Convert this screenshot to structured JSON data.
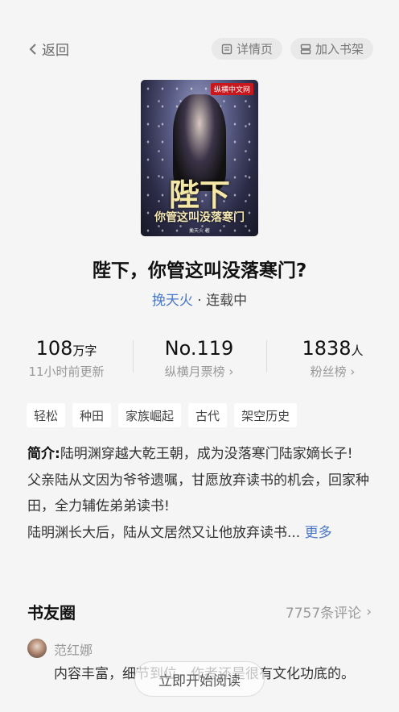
{
  "topbar": {
    "back_label": "返回",
    "detail_label": "详情页",
    "shelf_label": "加入书架"
  },
  "cover": {
    "logo": "纵横中文网",
    "title_big": "陛下",
    "title_small": "你管这叫没落寒门",
    "author_small": "挽天火 著"
  },
  "book": {
    "title": "陛下，你管这叫没落寒门?",
    "author": "挽天火",
    "status": "· 连载中"
  },
  "stats": [
    {
      "value": "108",
      "unit": "万字",
      "label": "11小时前更新"
    },
    {
      "value": "No.119",
      "unit": "",
      "label": "纵横月票榜"
    },
    {
      "value": "1838",
      "unit": "人",
      "label": "粉丝榜"
    }
  ],
  "tags": [
    "轻松",
    "种田",
    "家族崛起",
    "古代",
    "架空历史"
  ],
  "intro": {
    "label": "简介:",
    "line1": "陆明渊穿越大乾王朝，成为没落寒门陆家嫡长子!",
    "line2": "父亲陆从文因为爷爷遗嘱，甘愿放弃读书的机会，回家种田，全力辅佐弟弟读书!",
    "line3": "陆明渊长大后，陆从文居然又让他放弃读书...",
    "more": "更多"
  },
  "circle": {
    "title": "书友圈",
    "count": "7757条评论",
    "comment": {
      "user": "范红娜",
      "text": "内容丰富，细节到位，作者还是很有文化功底的。"
    }
  },
  "float_button": {
    "label": "立即开始阅读"
  },
  "colors": {
    "accent": "#4a77c9",
    "background": "#f5f5f5"
  }
}
